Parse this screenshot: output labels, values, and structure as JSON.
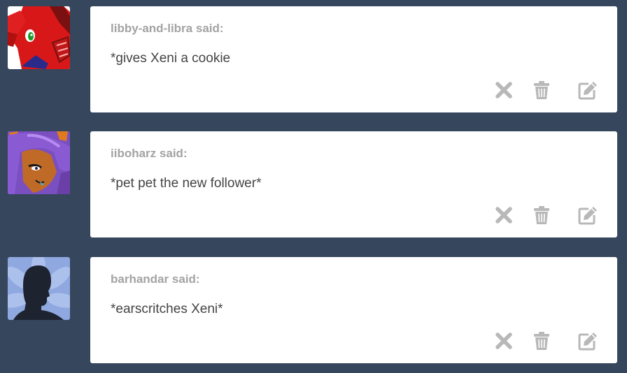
{
  "messages": [
    {
      "sender": "libby-and-libra",
      "said": "said:",
      "text": "*gives Xeni a cookie",
      "avatar": "red-pony-avatar"
    },
    {
      "sender": "iiboharz",
      "said": "said:",
      "text": "*pet pet the new follower*",
      "avatar": "purple-hair-pony-avatar"
    },
    {
      "sender": "barhandar",
      "said": "said:",
      "text": "*earscritches Xeni*",
      "avatar": "default-silhouette-avatar"
    }
  ],
  "actions": {
    "ignore_icon": "close-icon",
    "delete_icon": "trash-icon",
    "reply_icon": "edit-icon"
  },
  "colors": {
    "background": "#36465d",
    "card": "#ffffff",
    "sender": "#a3a3a3",
    "text": "#444444",
    "icon": "#b8b8b8"
  }
}
